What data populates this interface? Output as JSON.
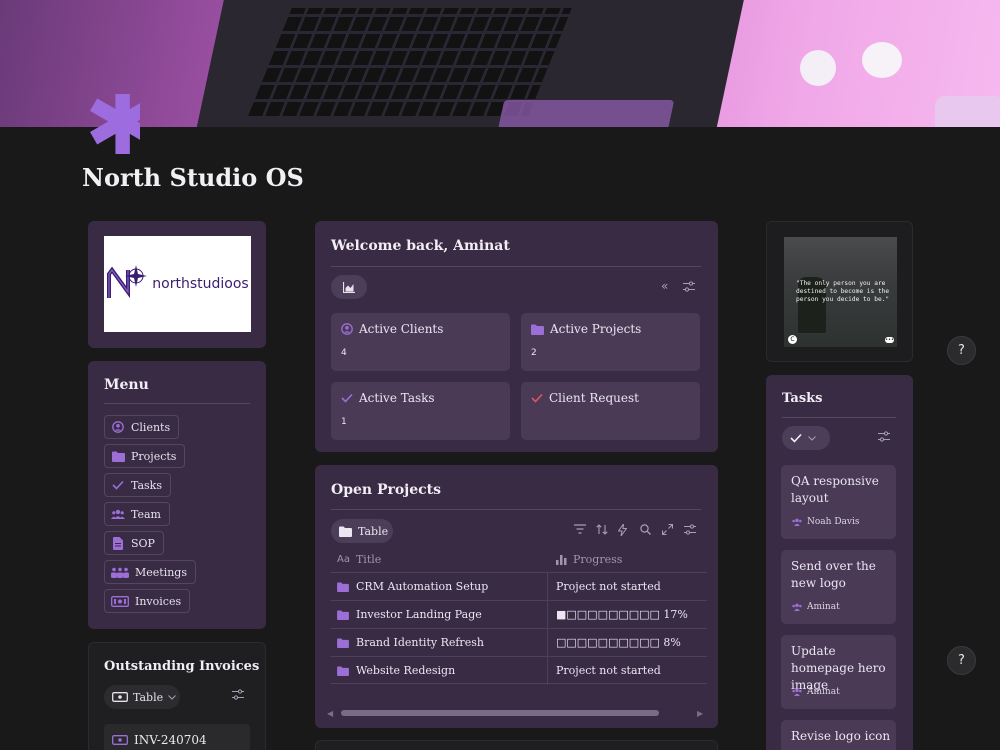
{
  "page": {
    "title": "North Studio OS"
  },
  "logo": {
    "text": "northstudioos"
  },
  "menu": {
    "title": "Menu",
    "items": [
      {
        "label": "Clients",
        "icon": "user-circle-icon"
      },
      {
        "label": "Projects",
        "icon": "folder-icon"
      },
      {
        "label": "Tasks",
        "icon": "check-icon"
      },
      {
        "label": "Team",
        "icon": "team-icon"
      },
      {
        "label": "SOP",
        "icon": "document-icon"
      },
      {
        "label": "Meetings",
        "icon": "meetings-icon"
      },
      {
        "label": "Invoices",
        "icon": "invoice-icon"
      }
    ]
  },
  "invoices": {
    "title": "Outstanding Invoices",
    "view_label": "Table",
    "rows": [
      {
        "id": "INV-240704"
      }
    ]
  },
  "welcome": {
    "title": "Welcome back, Aminat",
    "stats": [
      {
        "label": "Active Clients",
        "value": "4"
      },
      {
        "label": "Active Projects",
        "value": "2"
      },
      {
        "label": "Active Tasks",
        "value": "1"
      },
      {
        "label": "Client Request",
        "value": ""
      }
    ]
  },
  "projects": {
    "title": "Open Projects",
    "view_label": "Table",
    "columns": {
      "title": "Title",
      "progress": "Progress"
    },
    "rows": [
      {
        "title": "CRM Automation Setup",
        "progress": "Project not started"
      },
      {
        "title": "Investor Landing Page",
        "progress": "■□□□□□□□□□ 17%"
      },
      {
        "title": "Brand Identity Refresh",
        "progress": "□□□□□□□□□□ 8%"
      },
      {
        "title": "Website Redesign",
        "progress": "Project not started"
      }
    ]
  },
  "quote": {
    "text": "\"The only person you are destined to become is the person you decide to be.\""
  },
  "tasks": {
    "title": "Tasks",
    "items": [
      {
        "title": "QA responsive layout",
        "assignee": "Noah Davis"
      },
      {
        "title": "Send over the new logo",
        "assignee": "Aminat"
      },
      {
        "title": "Update homepage hero image",
        "assignee": "Aminat"
      },
      {
        "title": "Revise logo icon",
        "assignee": ""
      }
    ]
  },
  "help": {
    "label": "?"
  },
  "colors": {
    "accent": "#9d6de0",
    "card": "#3a2b45",
    "background": "#191919",
    "red_check": "#e0565b"
  }
}
